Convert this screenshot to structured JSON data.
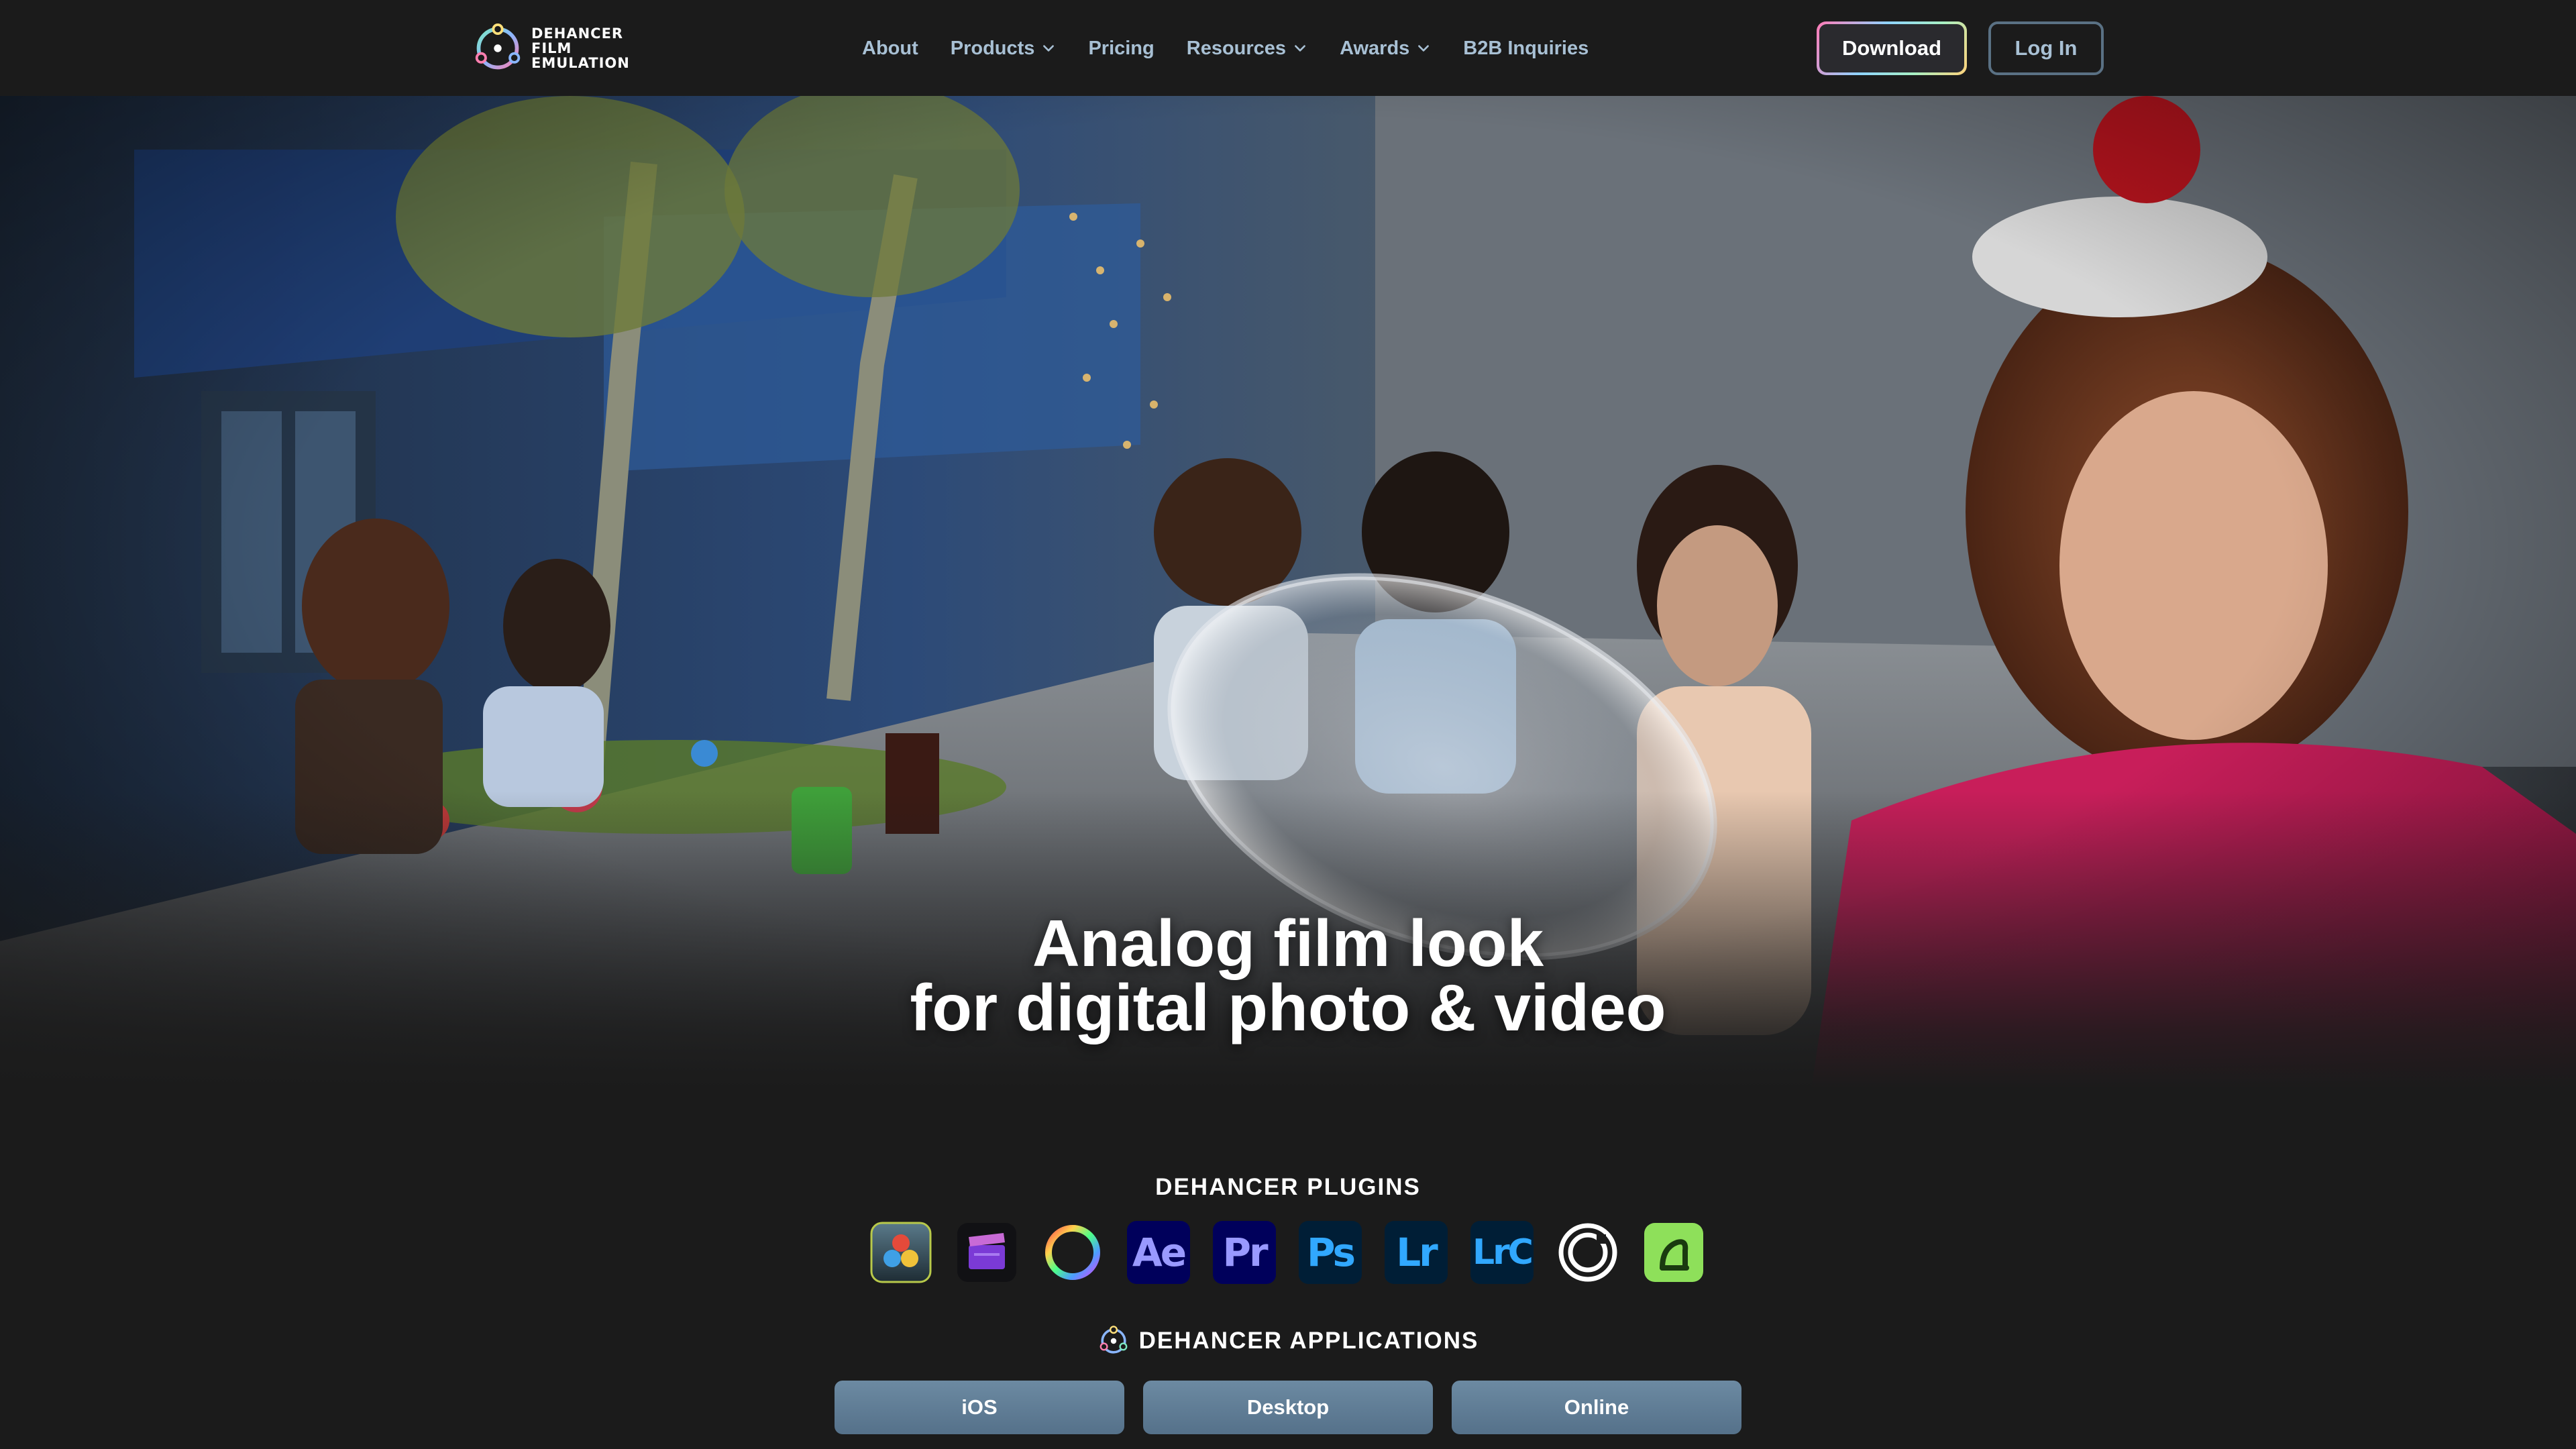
{
  "brand": {
    "logo_lines": [
      "DEHANCER",
      "FILM",
      "EMULATION"
    ]
  },
  "nav": {
    "items": [
      {
        "label": "About",
        "has_dropdown": false
      },
      {
        "label": "Products",
        "has_dropdown": true
      },
      {
        "label": "Pricing",
        "has_dropdown": false
      },
      {
        "label": "Resources",
        "has_dropdown": true
      },
      {
        "label": "Awards",
        "has_dropdown": true
      },
      {
        "label": "B2B Inquiries",
        "has_dropdown": false
      }
    ]
  },
  "header": {
    "download_label": "Download",
    "login_label": "Log In"
  },
  "hero": {
    "title_line1": "Analog film look",
    "title_line2": "for digital photo & video"
  },
  "plugins": {
    "title": "DEHANCER PLUGINS",
    "items": [
      {
        "icon": "davinci-resolve-icon"
      },
      {
        "icon": "final-cut-pro-icon"
      },
      {
        "icon": "color-wheel-icon"
      },
      {
        "icon": "after-effects-icon",
        "text": "Ae"
      },
      {
        "icon": "premiere-pro-icon",
        "text": "Pr"
      },
      {
        "icon": "photoshop-icon",
        "text": "Ps"
      },
      {
        "icon": "lightroom-icon",
        "text": "Lr"
      },
      {
        "icon": "lightroom-classic-icon",
        "text": "LrC"
      },
      {
        "icon": "capture-one-icon"
      },
      {
        "icon": "affinity-icon"
      }
    ]
  },
  "applications": {
    "title": "DEHANCER APPLICATIONS",
    "buttons": [
      "iOS",
      "Desktop",
      "Online"
    ]
  },
  "colors": {
    "background": "#1b1b1b",
    "nav_text": "#a8c0d4",
    "app_button": "#6c8aa2"
  }
}
